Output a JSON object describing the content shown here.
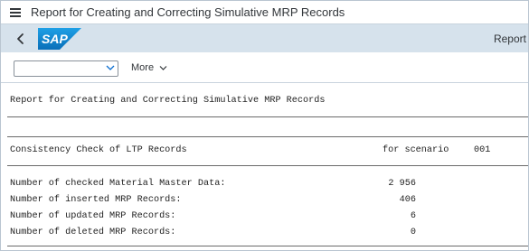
{
  "window": {
    "title": "Report for Creating and Correcting Simulative MRP Records",
    "menu_icon": "hamburger-menu-icon"
  },
  "shell": {
    "logo_text": "SAP",
    "title": "Report",
    "back_icon": "chevron-left-icon",
    "colors": {
      "shell_bg": "#d6e2ec",
      "logo_blue": "#0a7bc4"
    }
  },
  "toolbar": {
    "variant_select_value": "",
    "more_label": "More"
  },
  "report": {
    "heading": "Report for Creating and Correcting Simulative MRP Records",
    "section_title": "Consistency Check of LTP Records",
    "scenario_label": "for scenario",
    "scenario_value": "001",
    "rows": [
      {
        "label": "Number of checked Material Master Data:",
        "value": "2 956"
      },
      {
        "label": "Number of inserted MRP Records:",
        "value": "406"
      },
      {
        "label": "Number of updated MRP Records:",
        "value": "6"
      },
      {
        "label": "Number of deleted MRP Records:",
        "value": "0"
      }
    ]
  }
}
